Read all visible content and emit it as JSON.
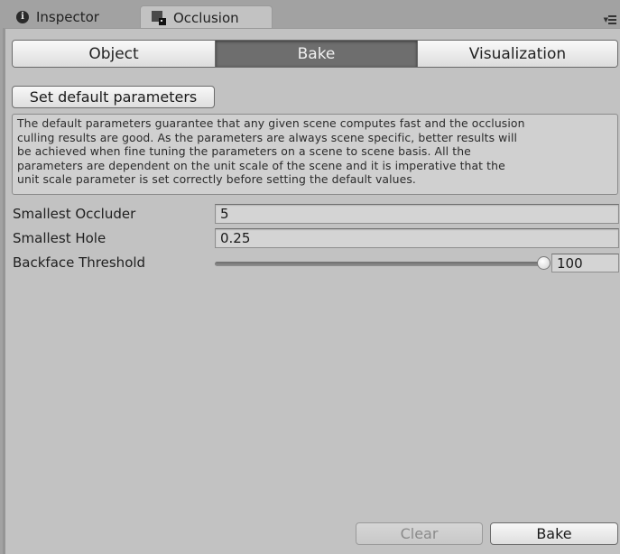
{
  "tabs": [
    {
      "label": "Inspector",
      "icon": "info-icon",
      "active": false
    },
    {
      "label": "Occlusion",
      "icon": "occlusion-icon",
      "active": true
    }
  ],
  "tab_menu_icon": "tab-menu-icon",
  "segments": [
    {
      "label": "Object",
      "selected": false
    },
    {
      "label": "Bake",
      "selected": true
    },
    {
      "label": "Visualization",
      "selected": false
    }
  ],
  "set_default_button": "Set default parameters",
  "help_text": "The default parameters guarantee that any given scene computes fast and the occlusion\nculling results are good. As the parameters are always scene specific, better results will\nbe achieved when fine tuning the parameters on a scene to scene basis. All the\nparameters are dependent on the unit scale of the scene and it is imperative that the\nunit scale parameter is set correctly before setting the default values.",
  "fields": {
    "smallest_occluder": {
      "label": "Smallest Occluder",
      "value": "5"
    },
    "smallest_hole": {
      "label": "Smallest Hole",
      "value": "0.25"
    },
    "backface_threshold": {
      "label": "Backface Threshold",
      "value": "100",
      "min": 5,
      "max": 100,
      "fraction": 1.0
    }
  },
  "buttons": {
    "clear": {
      "label": "Clear",
      "enabled": false
    },
    "bake": {
      "label": "Bake",
      "enabled": true
    }
  },
  "info_glyph": "i"
}
